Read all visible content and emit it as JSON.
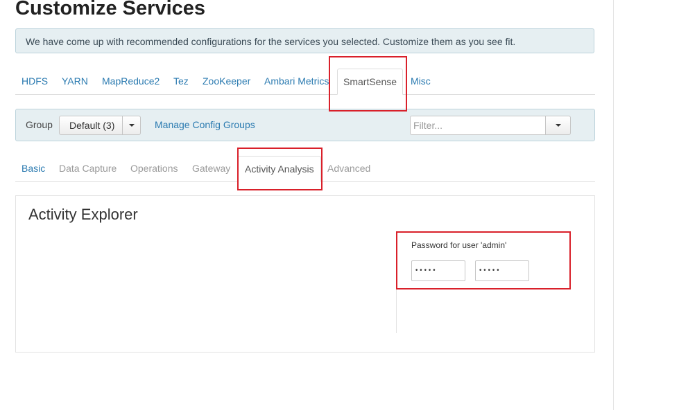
{
  "page": {
    "title": "Customize Services",
    "info_message": "We have come up with recommended configurations for the services you selected. Customize them as you see fit."
  },
  "service_tabs": [
    {
      "label": "HDFS"
    },
    {
      "label": "YARN"
    },
    {
      "label": "MapReduce2"
    },
    {
      "label": "Tez"
    },
    {
      "label": "ZooKeeper"
    },
    {
      "label": "Ambari Metrics"
    },
    {
      "label": "SmartSense",
      "active": true
    },
    {
      "label": "Misc"
    }
  ],
  "group_bar": {
    "group_label": "Group",
    "group_value": "Default (3)",
    "manage_link": "Manage Config Groups",
    "filter_placeholder": "Filter..."
  },
  "sub_tabs": [
    {
      "label": "Basic"
    },
    {
      "label": "Data Capture"
    },
    {
      "label": "Operations"
    },
    {
      "label": "Gateway"
    },
    {
      "label": "Activity Analysis",
      "active": true
    },
    {
      "label": "Advanced"
    }
  ],
  "panel": {
    "title": "Activity Explorer",
    "password_label": "Password for user 'admin'",
    "password_value": "•••••",
    "confirm_value": "•••••"
  },
  "colors": {
    "link": "#2a7ab0",
    "highlight": "#d9202a",
    "alert_bg": "#e6eff2"
  }
}
